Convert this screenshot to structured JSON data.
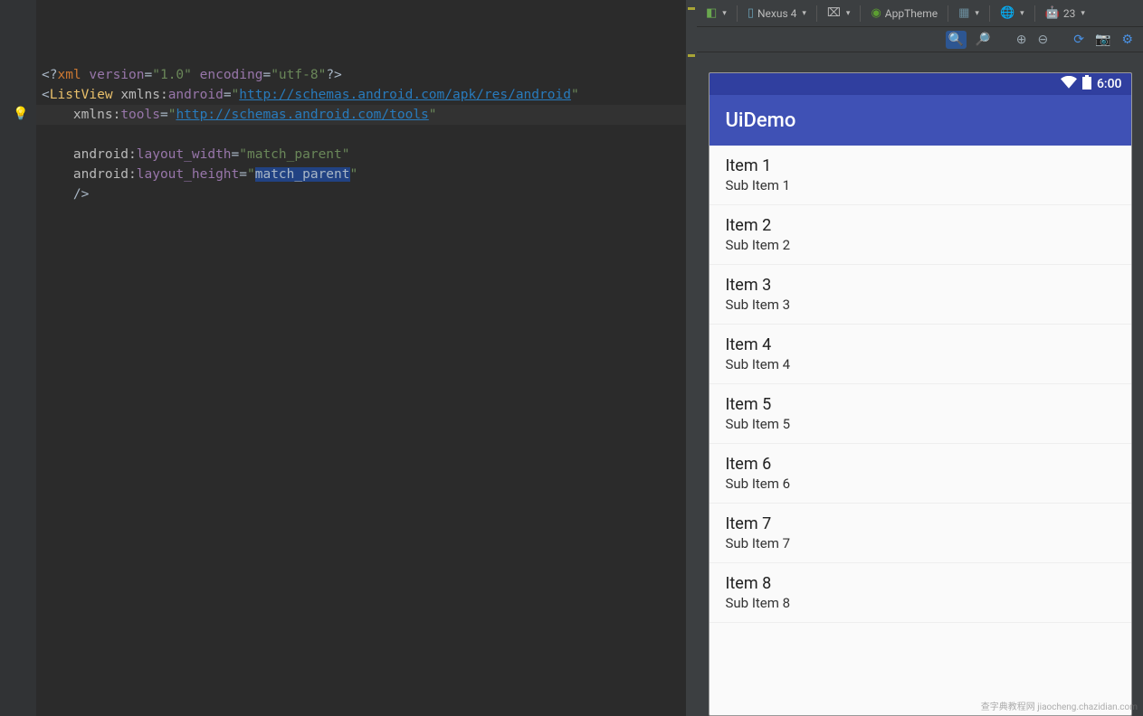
{
  "code": {
    "lines": [
      {
        "type": "decl",
        "parts": [
          [
            "",
            "<?"
          ],
          [
            "kw",
            "xml "
          ],
          [
            "attr",
            "version"
          ],
          [
            "",
            "="
          ],
          [
            "str",
            "\"1.0\""
          ],
          [
            "",
            " "
          ],
          [
            "attr",
            "encoding"
          ],
          [
            "",
            "="
          ],
          [
            "str",
            "\"utf-8\""
          ],
          [
            "",
            "?>"
          ]
        ]
      },
      {
        "type": "open",
        "parts": [
          [
            "",
            "<"
          ],
          [
            "tag",
            "ListView "
          ],
          [
            "attr-ns",
            "xmlns:"
          ],
          [
            "attr",
            "android"
          ],
          [
            "",
            "="
          ],
          [
            "str",
            "\""
          ],
          [
            "url",
            "http://schemas.android.com/apk/res/android"
          ],
          [
            "str",
            "\""
          ]
        ]
      },
      {
        "type": "cont",
        "indent": 4,
        "parts": [
          [
            "attr-ns",
            "xmlns:"
          ],
          [
            "attr",
            "tools"
          ],
          [
            "",
            "="
          ],
          [
            "str",
            "\""
          ],
          [
            "url",
            "http://schemas.android.com/tools"
          ],
          [
            "str",
            "\""
          ]
        ]
      },
      {
        "type": "blank"
      },
      {
        "type": "cont",
        "indent": 4,
        "parts": [
          [
            "attr-ns",
            "android:"
          ],
          [
            "attr",
            "layout_width"
          ],
          [
            "",
            "="
          ],
          [
            "str",
            "\"match_parent\""
          ]
        ]
      },
      {
        "type": "cont",
        "indent": 4,
        "highlight": true,
        "parts": [
          [
            "attr-ns",
            "android:"
          ],
          [
            "attr",
            "layout_height"
          ],
          [
            "",
            "="
          ],
          [
            "str",
            "\""
          ],
          [
            "selstr",
            "match_parent"
          ],
          [
            "str",
            "\""
          ]
        ]
      },
      {
        "type": "cont",
        "indent": 4,
        "parts": [
          [
            "",
            "/>"
          ]
        ]
      }
    ],
    "gutter_bulb_line": 5
  },
  "toolbar": {
    "config_dd": "",
    "device": "Nexus 4",
    "orientation_dd": "",
    "theme": "AppTheme",
    "layout_dd": "",
    "locale_dd": "",
    "api": "23",
    "api_prefix": ""
  },
  "preview": {
    "status_time": "6:00",
    "app_title": "UiDemo",
    "items": [
      {
        "title": "Item 1",
        "sub": "Sub Item 1"
      },
      {
        "title": "Item 2",
        "sub": "Sub Item 2"
      },
      {
        "title": "Item 3",
        "sub": "Sub Item 3"
      },
      {
        "title": "Item 4",
        "sub": "Sub Item 4"
      },
      {
        "title": "Item 5",
        "sub": "Sub Item 5"
      },
      {
        "title": "Item 6",
        "sub": "Sub Item 6"
      },
      {
        "title": "Item 7",
        "sub": "Sub Item 7"
      },
      {
        "title": "Item 8",
        "sub": "Sub Item 8"
      }
    ]
  },
  "watermark": "查字典教程网 jiaocheng.chazidian.com"
}
